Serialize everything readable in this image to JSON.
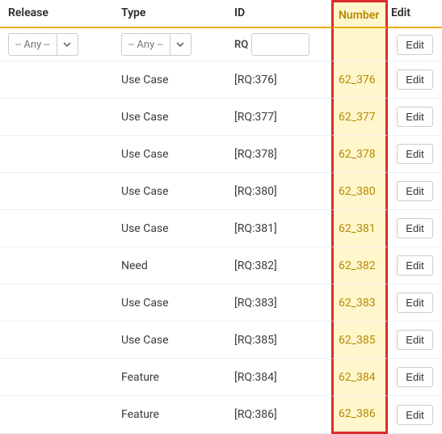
{
  "headers": {
    "release": "Release",
    "type": "Type",
    "id": "ID",
    "number": "Number",
    "edit": "Edit"
  },
  "filters": {
    "release_any": "-- Any --",
    "type_any": "-- Any --",
    "id_prefix": "RQ",
    "id_value": ""
  },
  "edit_label": "Edit",
  "rows": [
    {
      "release": "",
      "type": "Use Case",
      "id": "[RQ:376]",
      "number": "62_376"
    },
    {
      "release": "",
      "type": "Use Case",
      "id": "[RQ:377]",
      "number": "62_377"
    },
    {
      "release": "",
      "type": "Use Case",
      "id": "[RQ:378]",
      "number": "62_378"
    },
    {
      "release": "",
      "type": "Use Case",
      "id": "[RQ:380]",
      "number": "62_380"
    },
    {
      "release": "",
      "type": "Use Case",
      "id": "[RQ:381]",
      "number": "62_381"
    },
    {
      "release": "",
      "type": "Need",
      "id": "[RQ:382]",
      "number": "62_382"
    },
    {
      "release": "",
      "type": "Use Case",
      "id": "[RQ:383]",
      "number": "62_383"
    },
    {
      "release": "",
      "type": "Use Case",
      "id": "[RQ:385]",
      "number": "62_385"
    },
    {
      "release": "",
      "type": "Feature",
      "id": "[RQ:384]",
      "number": "62_384"
    },
    {
      "release": "",
      "type": "Feature",
      "id": "[RQ:386]",
      "number": "62_386"
    }
  ]
}
